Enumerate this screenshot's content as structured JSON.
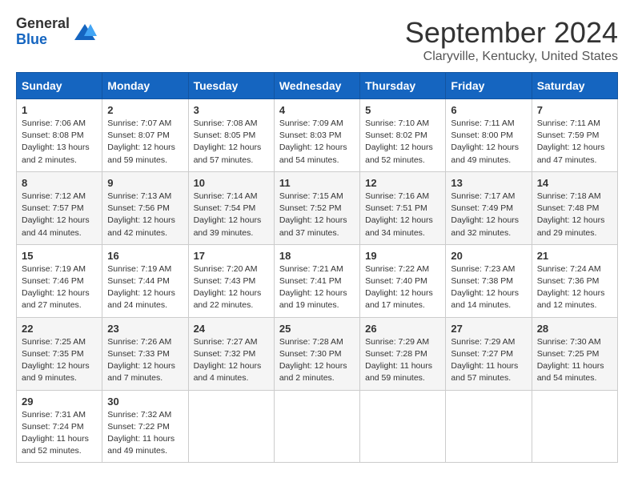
{
  "logo": {
    "general": "General",
    "blue": "Blue"
  },
  "title": "September 2024",
  "location": "Claryville, Kentucky, United States",
  "days_of_week": [
    "Sunday",
    "Monday",
    "Tuesday",
    "Wednesday",
    "Thursday",
    "Friday",
    "Saturday"
  ],
  "weeks": [
    [
      {
        "day": "1",
        "info": "Sunrise: 7:06 AM\nSunset: 8:08 PM\nDaylight: 13 hours\nand 2 minutes."
      },
      {
        "day": "2",
        "info": "Sunrise: 7:07 AM\nSunset: 8:07 PM\nDaylight: 12 hours\nand 59 minutes."
      },
      {
        "day": "3",
        "info": "Sunrise: 7:08 AM\nSunset: 8:05 PM\nDaylight: 12 hours\nand 57 minutes."
      },
      {
        "day": "4",
        "info": "Sunrise: 7:09 AM\nSunset: 8:03 PM\nDaylight: 12 hours\nand 54 minutes."
      },
      {
        "day": "5",
        "info": "Sunrise: 7:10 AM\nSunset: 8:02 PM\nDaylight: 12 hours\nand 52 minutes."
      },
      {
        "day": "6",
        "info": "Sunrise: 7:11 AM\nSunset: 8:00 PM\nDaylight: 12 hours\nand 49 minutes."
      },
      {
        "day": "7",
        "info": "Sunrise: 7:11 AM\nSunset: 7:59 PM\nDaylight: 12 hours\nand 47 minutes."
      }
    ],
    [
      {
        "day": "8",
        "info": "Sunrise: 7:12 AM\nSunset: 7:57 PM\nDaylight: 12 hours\nand 44 minutes."
      },
      {
        "day": "9",
        "info": "Sunrise: 7:13 AM\nSunset: 7:56 PM\nDaylight: 12 hours\nand 42 minutes."
      },
      {
        "day": "10",
        "info": "Sunrise: 7:14 AM\nSunset: 7:54 PM\nDaylight: 12 hours\nand 39 minutes."
      },
      {
        "day": "11",
        "info": "Sunrise: 7:15 AM\nSunset: 7:52 PM\nDaylight: 12 hours\nand 37 minutes."
      },
      {
        "day": "12",
        "info": "Sunrise: 7:16 AM\nSunset: 7:51 PM\nDaylight: 12 hours\nand 34 minutes."
      },
      {
        "day": "13",
        "info": "Sunrise: 7:17 AM\nSunset: 7:49 PM\nDaylight: 12 hours\nand 32 minutes."
      },
      {
        "day": "14",
        "info": "Sunrise: 7:18 AM\nSunset: 7:48 PM\nDaylight: 12 hours\nand 29 minutes."
      }
    ],
    [
      {
        "day": "15",
        "info": "Sunrise: 7:19 AM\nSunset: 7:46 PM\nDaylight: 12 hours\nand 27 minutes."
      },
      {
        "day": "16",
        "info": "Sunrise: 7:19 AM\nSunset: 7:44 PM\nDaylight: 12 hours\nand 24 minutes."
      },
      {
        "day": "17",
        "info": "Sunrise: 7:20 AM\nSunset: 7:43 PM\nDaylight: 12 hours\nand 22 minutes."
      },
      {
        "day": "18",
        "info": "Sunrise: 7:21 AM\nSunset: 7:41 PM\nDaylight: 12 hours\nand 19 minutes."
      },
      {
        "day": "19",
        "info": "Sunrise: 7:22 AM\nSunset: 7:40 PM\nDaylight: 12 hours\nand 17 minutes."
      },
      {
        "day": "20",
        "info": "Sunrise: 7:23 AM\nSunset: 7:38 PM\nDaylight: 12 hours\nand 14 minutes."
      },
      {
        "day": "21",
        "info": "Sunrise: 7:24 AM\nSunset: 7:36 PM\nDaylight: 12 hours\nand 12 minutes."
      }
    ],
    [
      {
        "day": "22",
        "info": "Sunrise: 7:25 AM\nSunset: 7:35 PM\nDaylight: 12 hours\nand 9 minutes."
      },
      {
        "day": "23",
        "info": "Sunrise: 7:26 AM\nSunset: 7:33 PM\nDaylight: 12 hours\nand 7 minutes."
      },
      {
        "day": "24",
        "info": "Sunrise: 7:27 AM\nSunset: 7:32 PM\nDaylight: 12 hours\nand 4 minutes."
      },
      {
        "day": "25",
        "info": "Sunrise: 7:28 AM\nSunset: 7:30 PM\nDaylight: 12 hours\nand 2 minutes."
      },
      {
        "day": "26",
        "info": "Sunrise: 7:29 AM\nSunset: 7:28 PM\nDaylight: 11 hours\nand 59 minutes."
      },
      {
        "day": "27",
        "info": "Sunrise: 7:29 AM\nSunset: 7:27 PM\nDaylight: 11 hours\nand 57 minutes."
      },
      {
        "day": "28",
        "info": "Sunrise: 7:30 AM\nSunset: 7:25 PM\nDaylight: 11 hours\nand 54 minutes."
      }
    ],
    [
      {
        "day": "29",
        "info": "Sunrise: 7:31 AM\nSunset: 7:24 PM\nDaylight: 11 hours\nand 52 minutes."
      },
      {
        "day": "30",
        "info": "Sunrise: 7:32 AM\nSunset: 7:22 PM\nDaylight: 11 hours\nand 49 minutes."
      },
      {
        "day": "",
        "info": ""
      },
      {
        "day": "",
        "info": ""
      },
      {
        "day": "",
        "info": ""
      },
      {
        "day": "",
        "info": ""
      },
      {
        "day": "",
        "info": ""
      }
    ]
  ]
}
